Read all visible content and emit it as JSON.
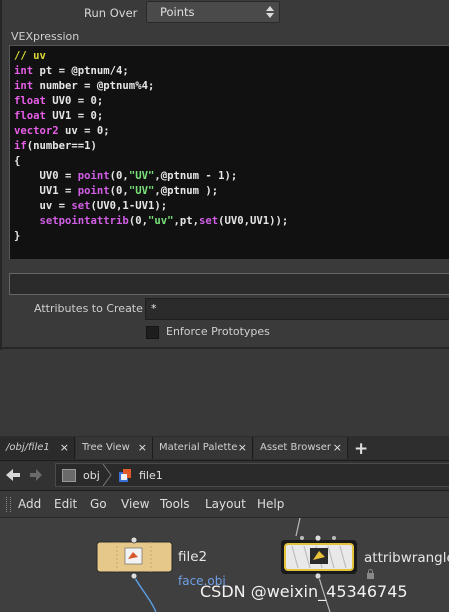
{
  "params": {
    "run_over_label": "Run Over",
    "run_over_value": "Points",
    "vex_label": "VEXpression",
    "code_lines": [
      [
        {
          "t": "// uv",
          "c": "cm"
        }
      ],
      [
        {
          "t": "int",
          "c": "kw"
        },
        {
          "t": " pt = @ptnum/4;",
          "c": ""
        }
      ],
      [
        {
          "t": "int",
          "c": "kw"
        },
        {
          "t": " number = @ptnum%4;",
          "c": ""
        }
      ],
      [
        {
          "t": "float",
          "c": "kw"
        },
        {
          "t": " UV0 = 0;",
          "c": ""
        }
      ],
      [
        {
          "t": "float",
          "c": "kw"
        },
        {
          "t": " UV1 = 0;",
          "c": ""
        }
      ],
      [
        {
          "t": "vector2",
          "c": "kw"
        },
        {
          "t": " uv = 0;",
          "c": ""
        }
      ],
      [
        {
          "t": "if",
          "c": "kw"
        },
        {
          "t": "(number==1)",
          "c": ""
        }
      ],
      [
        {
          "t": "{",
          "c": ""
        }
      ],
      [
        {
          "t": "    UV0 = ",
          "c": ""
        },
        {
          "t": "point",
          "c": "fn"
        },
        {
          "t": "(0,",
          "c": ""
        },
        {
          "t": "\"UV\"",
          "c": "st"
        },
        {
          "t": ",@ptnum - 1);",
          "c": ""
        }
      ],
      [
        {
          "t": "    UV1 = ",
          "c": ""
        },
        {
          "t": "point",
          "c": "fn"
        },
        {
          "t": "(0,",
          "c": ""
        },
        {
          "t": "\"UV\"",
          "c": "st"
        },
        {
          "t": ",@ptnum );",
          "c": ""
        }
      ],
      [
        {
          "t": "    uv = ",
          "c": ""
        },
        {
          "t": "set",
          "c": "fn"
        },
        {
          "t": "(UV0,1-UV1);",
          "c": ""
        }
      ],
      [
        {
          "t": "    ",
          "c": ""
        },
        {
          "t": "setpointattrib",
          "c": "fn"
        },
        {
          "t": "(0,",
          "c": ""
        },
        {
          "t": "\"uv\"",
          "c": "st"
        },
        {
          "t": ",pt,",
          "c": ""
        },
        {
          "t": "set",
          "c": "fn"
        },
        {
          "t": "(UV0,UV1));",
          "c": ""
        }
      ],
      [
        {
          "t": "}",
          "c": ""
        }
      ]
    ],
    "attributes_label": "Attributes to Create",
    "attributes_value": "*",
    "enforce_label": "Enforce Prototypes",
    "enforce_checked": false
  },
  "tabs": [
    {
      "label": "/obj/file1",
      "close": "×"
    },
    {
      "label": "Tree View",
      "close": "×"
    },
    {
      "label": "Material Palette",
      "close": "×"
    },
    {
      "label": "Asset Browser",
      "close": "×"
    }
  ],
  "tab_add": "+",
  "path": {
    "back_icon": "back-arrow-icon",
    "forward_icon": "forward-arrow-icon",
    "crumbs": [
      "obj",
      "file1"
    ]
  },
  "menu": [
    "Add",
    "Edit",
    "Go",
    "View",
    "Tools",
    "Layout",
    "Help"
  ],
  "network": {
    "nodes": [
      {
        "name": "file2",
        "comment": "face.obj",
        "color": "#e6c98a"
      },
      {
        "name": "attribwrangle",
        "color": "#e8e8e8"
      }
    ],
    "wire_color": "#5aa0e8"
  },
  "watermark": "CSDN @weixin_45346745"
}
